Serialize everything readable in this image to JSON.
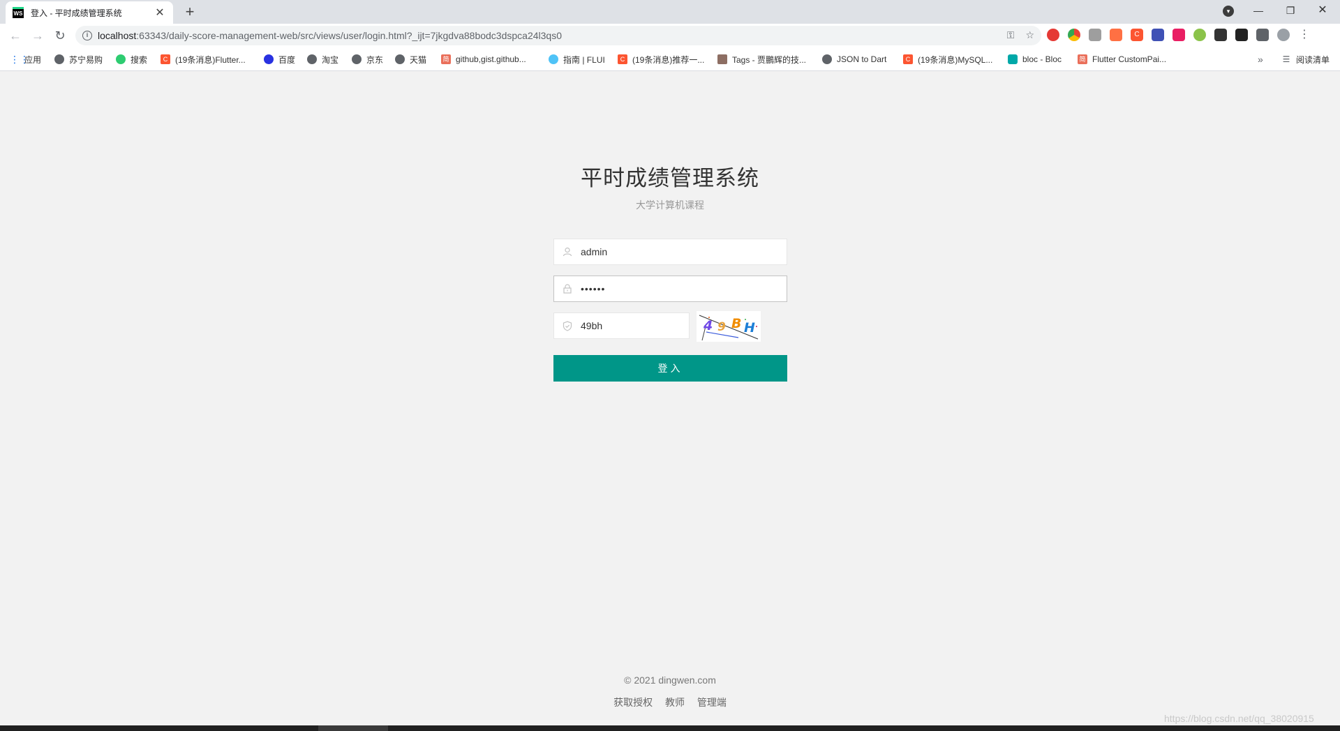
{
  "browser": {
    "tab_title": "登入 - 平时成绩管理系统",
    "tab_favicon_text": "WS",
    "url_host": "localhost",
    "url_rest": ":63343/daily-score-management-web/src/views/user/login.html?_ijt=7jkgdva88bodc3dspca24l3qs0",
    "reading_list": "阅读清单",
    "bookmarks": [
      {
        "label": "应用",
        "icon": "apps-icon"
      },
      {
        "label": "苏宁易购",
        "icon": "globe-icon"
      },
      {
        "label": "搜索",
        "icon": "search-icon"
      },
      {
        "label": "(19条消息)Flutter...",
        "icon": "csdn-icon"
      },
      {
        "label": "百度",
        "icon": "baidu-icon"
      },
      {
        "label": "淘宝",
        "icon": "globe-icon"
      },
      {
        "label": "京东",
        "icon": "globe-icon"
      },
      {
        "label": "天猫",
        "icon": "globe-icon"
      },
      {
        "label": "github,gist.github...",
        "icon": "jianshu-icon"
      },
      {
        "label": "指南 | FLUI",
        "icon": "flui-icon"
      },
      {
        "label": "(19条消息)推荐一...",
        "icon": "csdn-icon"
      },
      {
        "label": "Tags - 贾鵬辉的技...",
        "icon": "tags-icon"
      },
      {
        "label": "JSON to Dart",
        "icon": "globe-icon"
      },
      {
        "label": "(19条消息)MySQL...",
        "icon": "csdn-icon"
      },
      {
        "label": "bloc - Bloc",
        "icon": "bloc-icon"
      },
      {
        "label": "Flutter CustomPai...",
        "icon": "jianshu-icon"
      }
    ]
  },
  "login": {
    "title": "平时成绩管理系统",
    "subtitle": "大学计算机课程",
    "username_value": "admin",
    "password_value": "••••••",
    "captcha_value": "49bh",
    "captcha_image_text": "49BH",
    "submit_label": "登入"
  },
  "footer": {
    "copyright": "© 2021   dingwen.com",
    "links": [
      "获取授权",
      "教师",
      "管理端"
    ]
  },
  "watermark": "https://blog.csdn.net/qq_38020915",
  "colors": {
    "primary": "#009688",
    "background": "#f2f2f2"
  }
}
